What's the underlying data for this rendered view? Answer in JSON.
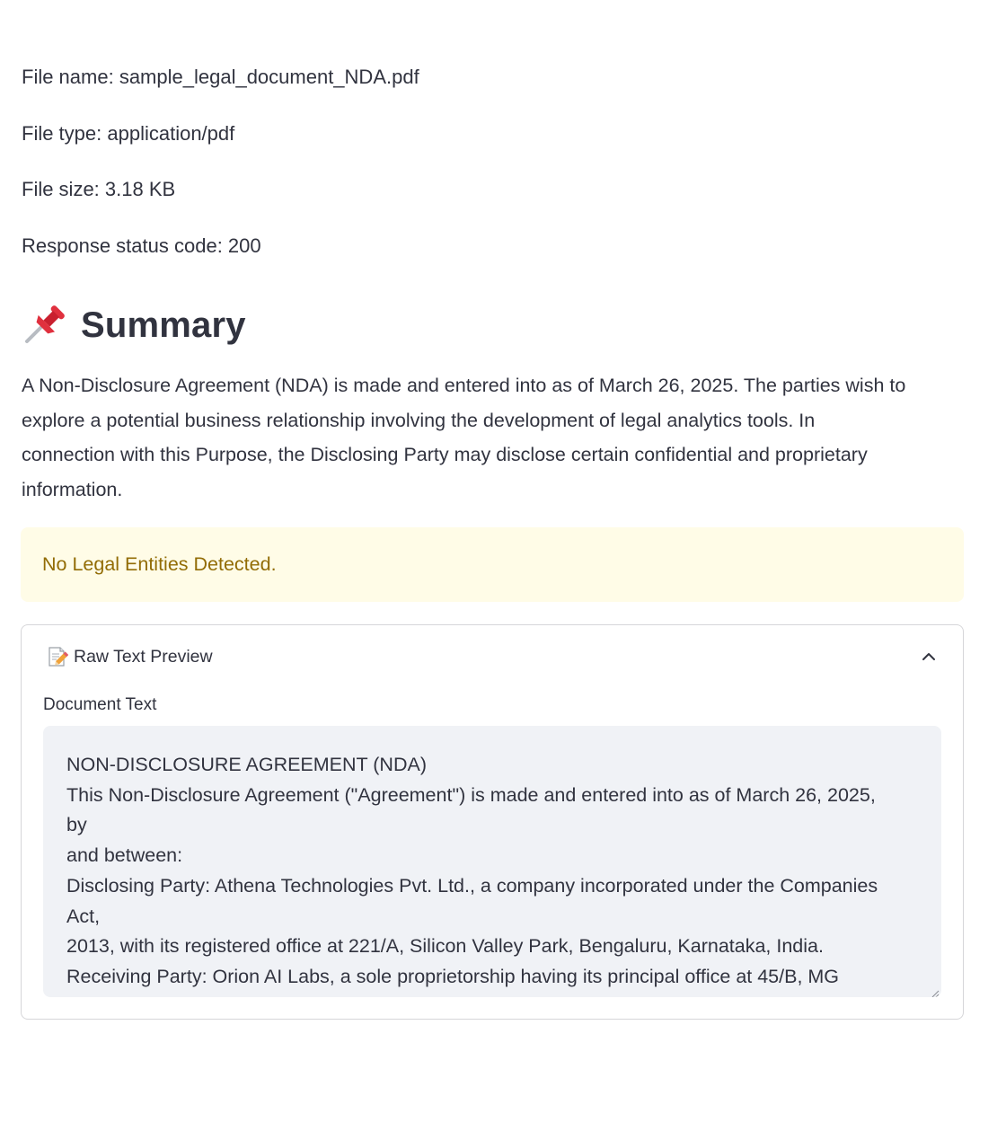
{
  "file_info": {
    "name": "File name: sample_legal_document_NDA.pdf",
    "type": "File type: application/pdf",
    "size": "File size: 3.18 KB",
    "status": "Response status code: 200"
  },
  "summary": {
    "icon": "pushpin-icon",
    "title": "Summary",
    "lines": [
      "A Non-Disclosure Agreement (NDA) is made and entered into as of March 26, 2025. The parties wish to",
      "explore a potential business relationship involving the development of legal analytics tools. In",
      "connection with this Purpose, the Disclosing Party may disclose certain confidential and proprietary",
      "information."
    ]
  },
  "warning": {
    "text": "No Legal Entities Detected.",
    "background": "#fffce7",
    "color": "#926c05"
  },
  "expander": {
    "icon": "memo-icon",
    "label": "Raw Text Preview",
    "state_icon": "chevron-up-icon",
    "textarea_label": "Document Text",
    "text_lines": [
      "NON-DISCLOSURE AGREEMENT (NDA)",
      "This Non-Disclosure Agreement (\"Agreement\") is made and entered into as of March 26, 2025,",
      "by",
      "and between:",
      "Disclosing Party: Athena Technologies Pvt. Ltd., a company incorporated under the Companies",
      "Act,",
      "2013, with its registered office at 221/A, Silicon Valley Park, Bengaluru, Karnataka, India.",
      "Receiving Party: Orion AI Labs, a sole proprietorship having its principal office at 45/B, MG"
    ]
  }
}
